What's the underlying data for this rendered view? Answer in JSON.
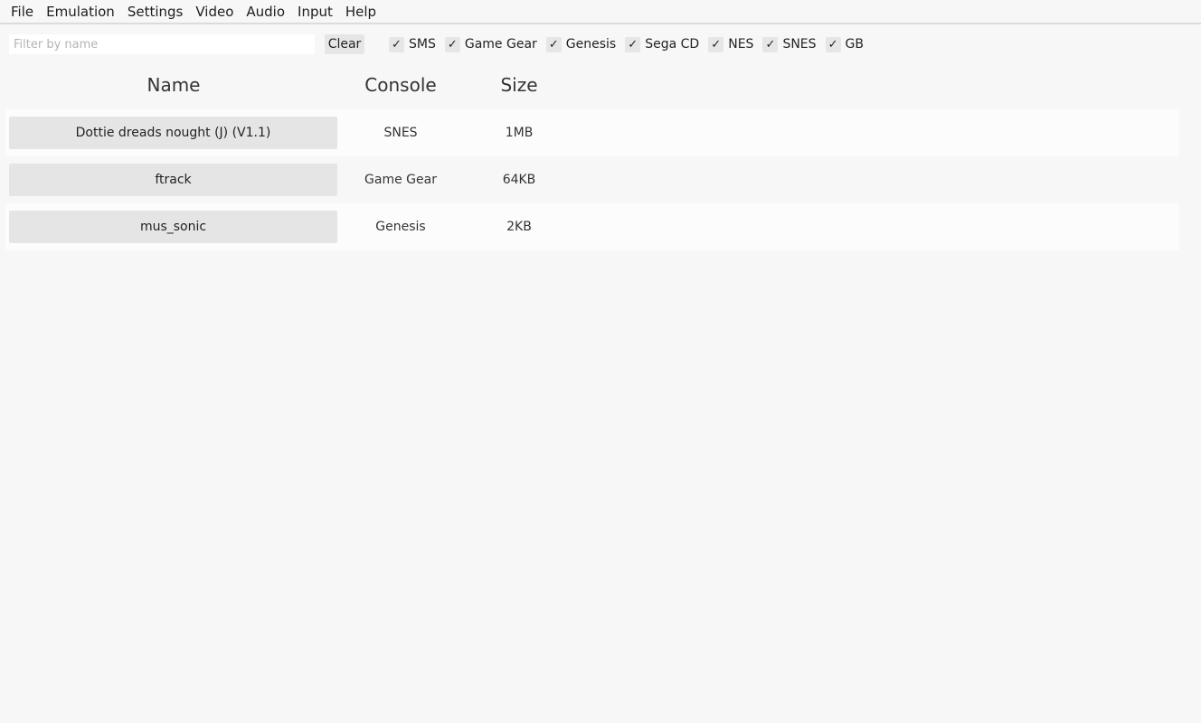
{
  "menu": {
    "items": [
      {
        "label": "File"
      },
      {
        "label": "Emulation"
      },
      {
        "label": "Settings"
      },
      {
        "label": "Video"
      },
      {
        "label": "Audio"
      },
      {
        "label": "Input"
      },
      {
        "label": "Help"
      }
    ]
  },
  "filter": {
    "placeholder": "Filter by name",
    "value": "",
    "clear_label": "Clear",
    "check_glyph": "✓",
    "consoles": [
      {
        "label": "SMS",
        "checked": true
      },
      {
        "label": "Game Gear",
        "checked": true
      },
      {
        "label": "Genesis",
        "checked": true
      },
      {
        "label": "Sega CD",
        "checked": true
      },
      {
        "label": "NES",
        "checked": true
      },
      {
        "label": "SNES",
        "checked": true
      },
      {
        "label": "GB",
        "checked": true
      }
    ]
  },
  "table": {
    "headers": {
      "name": "Name",
      "console": "Console",
      "size": "Size"
    },
    "rows": [
      {
        "name": "Dottie dreads nought (J) (V1.1)",
        "console": "SNES",
        "size": "1MB"
      },
      {
        "name": "ftrack",
        "console": "Game Gear",
        "size": "64KB"
      },
      {
        "name": "mus_sonic",
        "console": "Genesis",
        "size": "2KB"
      }
    ]
  }
}
